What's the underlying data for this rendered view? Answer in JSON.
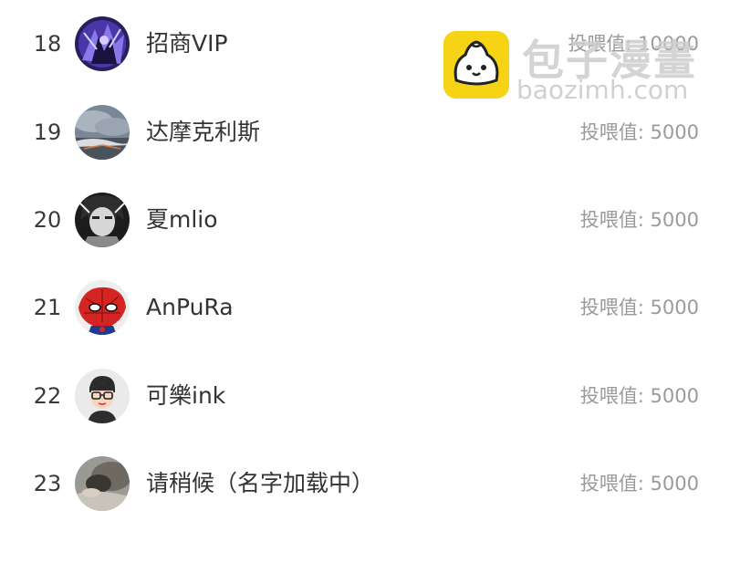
{
  "watermark": {
    "logo_icon": "bun-face-icon",
    "title": "包子漫畫",
    "url": "baozimh.com"
  },
  "ranking": {
    "rows": [
      {
        "rank": "18",
        "name": "招商VIP",
        "value": "投喂值: 10000",
        "avatar_icon": "purple-knight-avatar"
      },
      {
        "rank": "19",
        "name": "达摩克利斯",
        "value": "投喂值: 5000",
        "avatar_icon": "cloudy-sky-avatar"
      },
      {
        "rank": "20",
        "name": "夏mlio",
        "value": "投喂值: 5000",
        "avatar_icon": "monochrome-character-avatar"
      },
      {
        "rank": "21",
        "name": "AnPuRa",
        "value": "投喂值: 5000",
        "avatar_icon": "spider-hero-avatar"
      },
      {
        "rank": "22",
        "name": "可樂ink",
        "value": "投喂值: 5000",
        "avatar_icon": "glasses-boy-avatar"
      },
      {
        "rank": "23",
        "name": "请稍候（名字加载中）",
        "value": "投喂值: 5000",
        "avatar_icon": "sleeping-person-avatar"
      }
    ]
  }
}
